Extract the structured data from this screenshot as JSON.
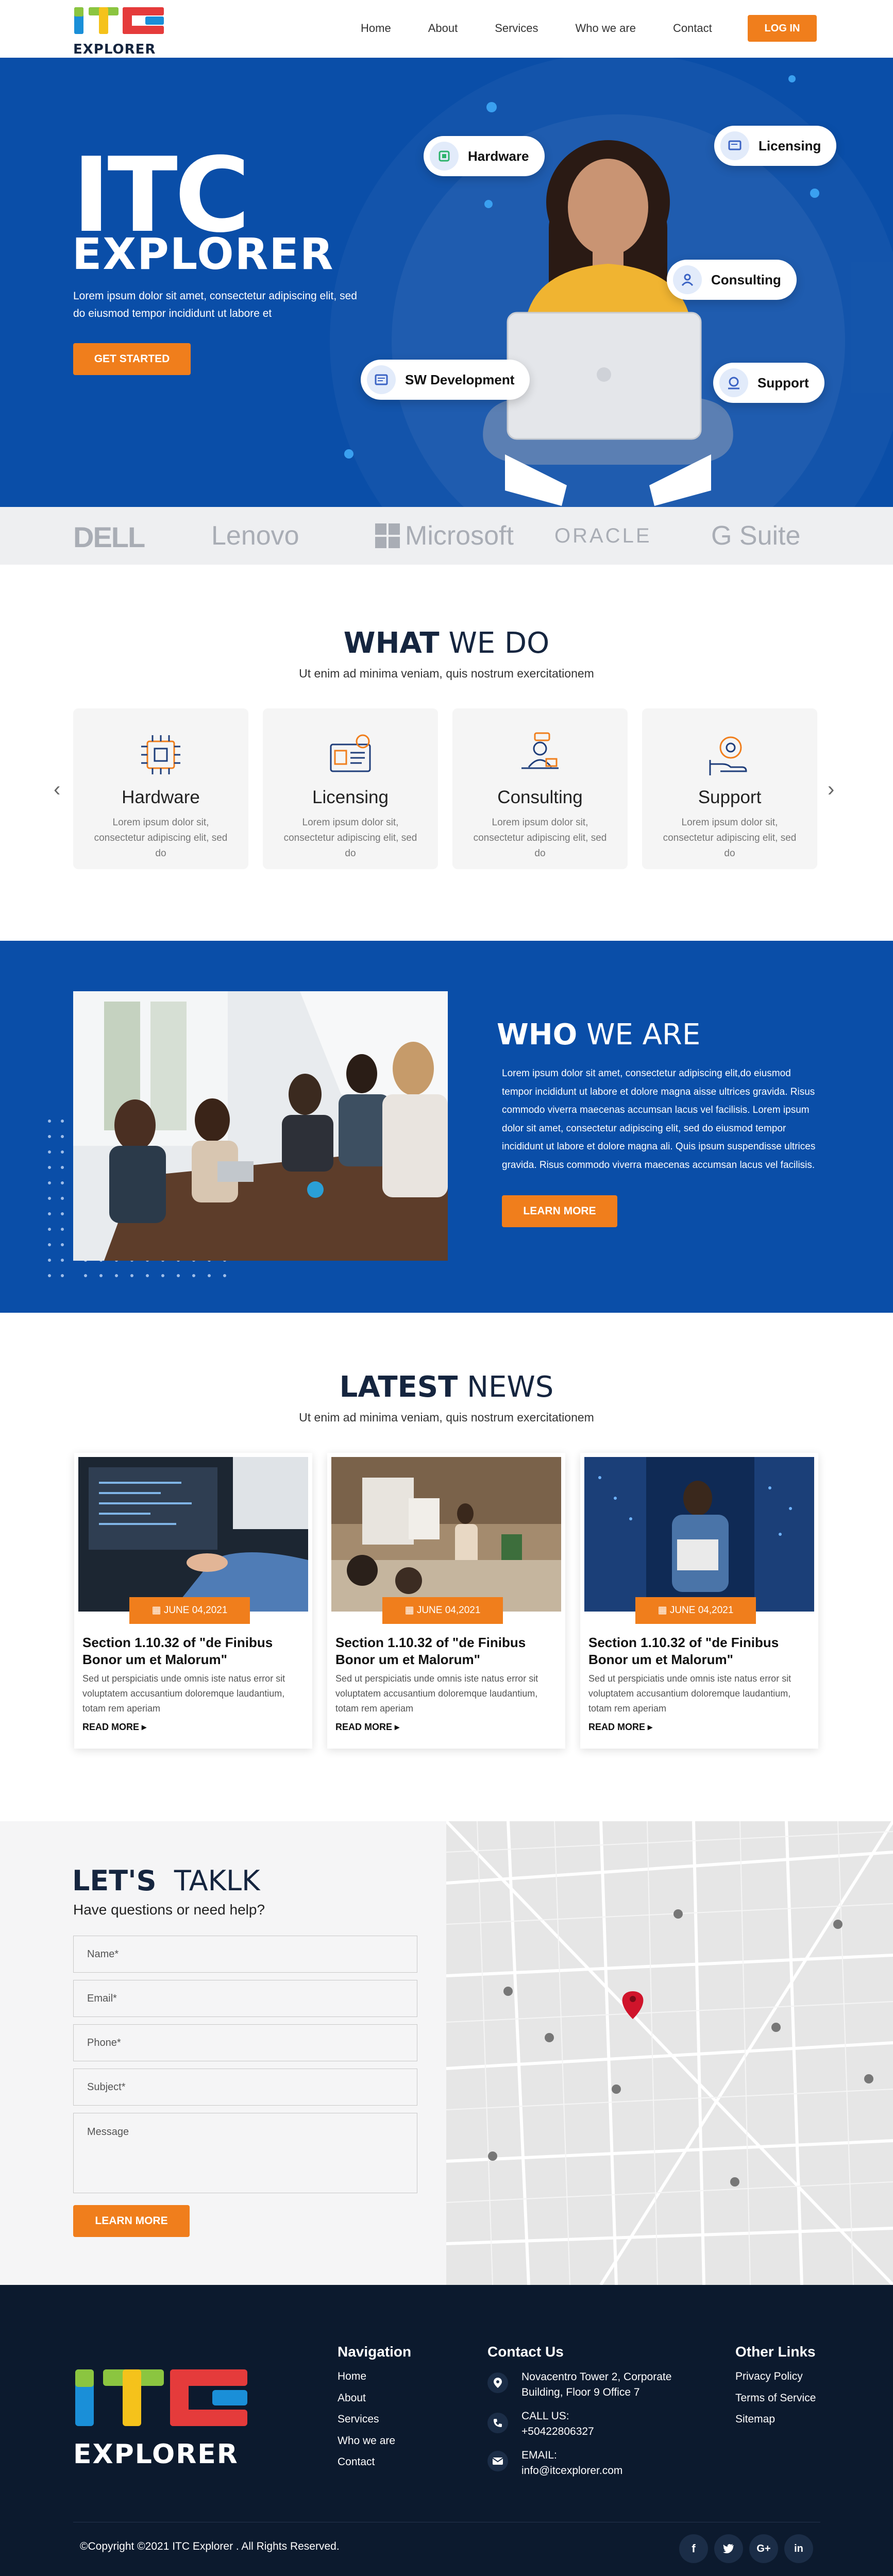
{
  "header": {
    "logo_text": "EXPLORER",
    "nav": [
      "Home",
      "About",
      "Services",
      "Who we are",
      "Contact"
    ],
    "login_label": "LOG IN"
  },
  "hero": {
    "title_line1": "ITC",
    "title_line2": "EXPLORER",
    "subtitle": "Lorem ipsum dolor sit amet, consectetur adipiscing elit, sed do eiusmod tempor incididunt ut labore et",
    "cta_label": "GET STARTED",
    "pills": [
      "Hardware",
      "Licensing",
      "Consulting",
      "SW Development",
      "Support"
    ]
  },
  "brands": [
    "DELL",
    "Lenovo",
    "Microsoft",
    "ORACLE",
    "G Suite"
  ],
  "what_we_do": {
    "title_bold": "WHAT",
    "title_rest": "WE DO",
    "subtitle": "Ut enim ad minima veniam, quis nostrum exercitationem",
    "services": [
      {
        "title": "Hardware",
        "desc": "Lorem ipsum dolor sit, consectetur adipiscing elit, sed do"
      },
      {
        "title": "Licensing",
        "desc": "Lorem ipsum dolor sit, consectetur adipiscing elit, sed do"
      },
      {
        "title": "Consulting",
        "desc": "Lorem ipsum dolor sit, consectetur adipiscing elit, sed do"
      },
      {
        "title": "Support",
        "desc": "Lorem ipsum dolor sit, consectetur adipiscing elit, sed do"
      }
    ]
  },
  "who_we_are": {
    "title_bold": "WHO",
    "title_rest": "WE ARE",
    "text": "Lorem ipsum dolor sit amet, consectetur adipiscing elit,do eiusmod tempor incididunt ut labore et dolore magna aisse ultrices gravida. Risus commodo viverra maecenas accumsan lacus vel facilisis. Lorem ipsum dolor sit amet, consectetur adipiscing elit, sed do eiusmod tempor incididunt ut labore et dolore magna ali. Quis ipsum suspendisse ultrices gravida. Risus commodo viverra maecenas accumsan lacus vel facilisis.",
    "cta_label": "LEARN MORE"
  },
  "latest_news": {
    "title_bold": "LATEST",
    "title_rest": "NEWS",
    "subtitle": "Ut enim ad minima veniam, quis nostrum exercitationem",
    "items": [
      {
        "date": "JUNE 04,2021",
        "title": "Section 1.10.32 of \"de Finibus Bonor um et Malorum\"",
        "desc": "Sed ut perspiciatis unde omnis iste natus error sit voluptatem accusantium doloremque laudantium, totam rem aperiam",
        "read_more": "READ MORE"
      },
      {
        "date": "JUNE 04,2021",
        "title": "Section 1.10.32 of \"de Finibus Bonor um et Malorum\"",
        "desc": "Sed ut perspiciatis unde omnis iste natus error sit voluptatem accusantium doloremque laudantium, totam rem aperiam",
        "read_more": "READ MORE"
      },
      {
        "date": "JUNE 04,2021",
        "title": "Section 1.10.32 of \"de Finibus Bonor um et Malorum\"",
        "desc": "Sed ut perspiciatis unde omnis iste natus error sit voluptatem accusantium doloremque laudantium, totam rem aperiam",
        "read_more": "READ MORE"
      }
    ]
  },
  "contact": {
    "title_bold": "LET'S",
    "title_rest": "TAKLK",
    "subtitle": "Have questions or need help?",
    "placeholders": {
      "name": "Name*",
      "email": "Email*",
      "phone": "Phone*",
      "subject": "Subject*",
      "message": "Message"
    },
    "submit_label": "LEARN MORE"
  },
  "footer": {
    "logo_text": "EXPLORER",
    "navigation_title": "Navigation",
    "navigation": [
      "Home",
      "About",
      "Services",
      "Who we are",
      "Contact"
    ],
    "contact_title": "Contact Us",
    "address": "Novacentro Tower 2, Corporate Building, Floor 9 Office 7",
    "call_label": "CALL US:",
    "phone": "+50422806327",
    "email_label": "EMAIL:",
    "email": "info@itcexplorer.com",
    "other_title": "Other Links",
    "other_links": [
      "Privacy Policy",
      "Terms of Service",
      "Sitemap"
    ],
    "copyright": "©Copyright ©2021 ITC Explorer . All Rights Reserved.",
    "social": [
      "f",
      "t",
      "G+",
      "in"
    ]
  },
  "colors": {
    "brand_blue": "#0a4ea8",
    "accent_orange": "#f07e1c",
    "dark_navy": "#0c1a2e",
    "heading": "#15253f"
  }
}
